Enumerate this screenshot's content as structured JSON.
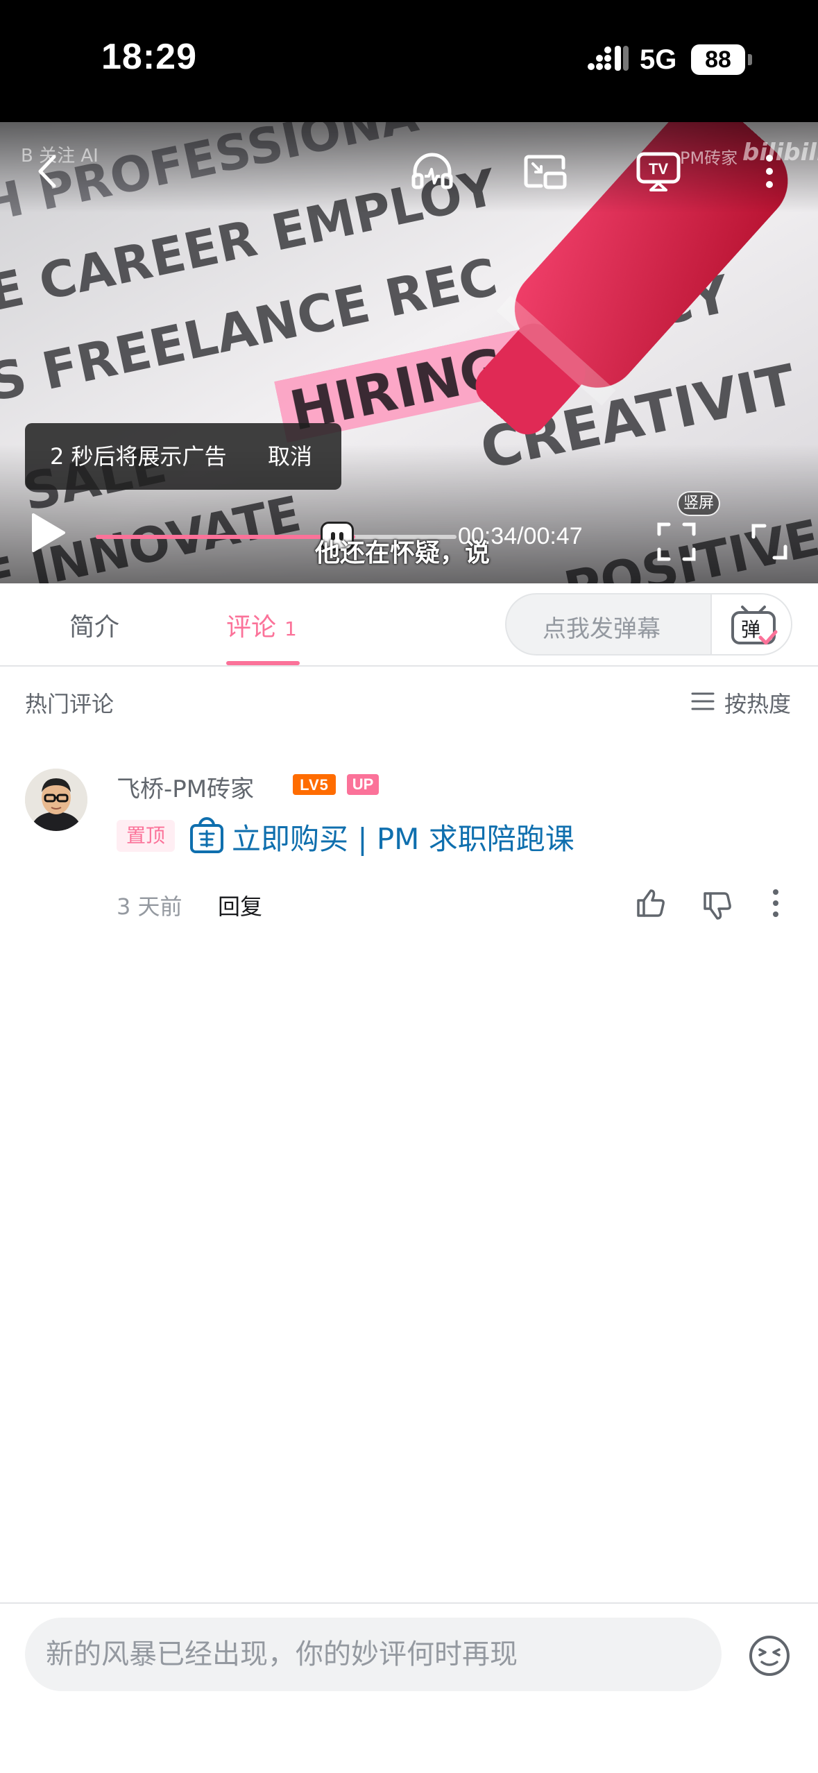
{
  "status_bar": {
    "time": "18:29",
    "network": "5G",
    "battery": "88"
  },
  "player": {
    "watermark_ai": "B 关注 AI",
    "watermark_brand": "PM砖家",
    "watermark_logo": "bilibili",
    "ad_notice": "2 秒后将展示广告",
    "ad_cancel": "取消",
    "subtitle": "他还在怀疑，说",
    "current_time": "00:34",
    "duration": "00:47",
    "time_display": "00:34/00:47",
    "progress": 0.72,
    "portrait_label": "竖屏",
    "icons": [
      "back-icon",
      "audio-mode-icon",
      "pip-icon",
      "tv-cast-icon",
      "more-icon",
      "play-icon",
      "fullscreen-portrait-icon",
      "fullscreen-icon"
    ]
  },
  "tabs": {
    "intro": "简介",
    "comments": "评论",
    "comment_count": "1",
    "danmaku_placeholder": "点我发弹幕",
    "danmaku_icon_char": "弹"
  },
  "comments_section": {
    "title": "热门评论",
    "sort_label": "按热度",
    "items": [
      {
        "username": "飞桥-PM砖家",
        "level_badge": "LV5",
        "up_badge": "UP",
        "pinned_tag": "置顶",
        "link_text": "立即购买 | PM 求职陪跑课",
        "time": "3 天前",
        "reply_label": "回复"
      }
    ]
  },
  "bottom_bar": {
    "input_placeholder": "新的风暴已经出现，你的妙评何时再现"
  },
  "colors": {
    "accent": "#fb7299",
    "link": "#0f6fae",
    "level": "#ff6c00",
    "muted": "#9499a0"
  }
}
